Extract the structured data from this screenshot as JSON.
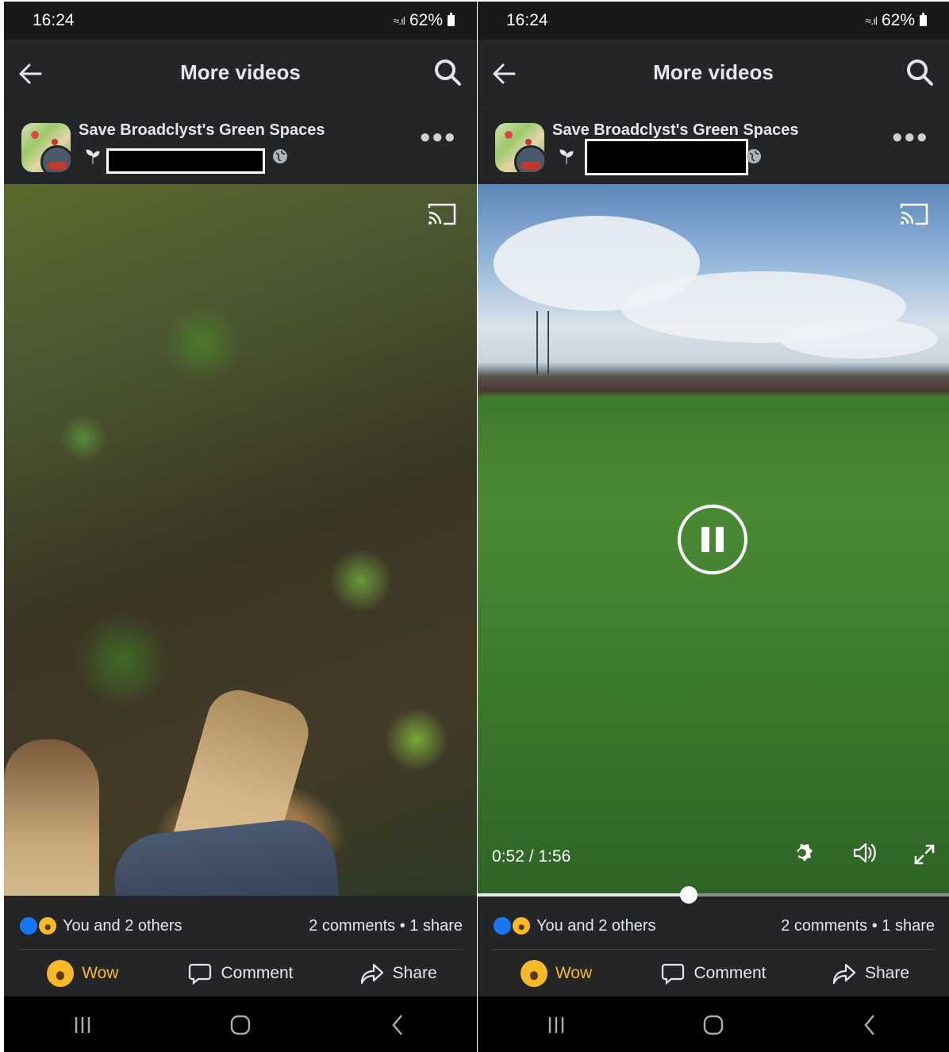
{
  "phones": [
    {
      "status": {
        "time": "16:24",
        "battery": "62%"
      },
      "topbar": {
        "title": "More videos"
      },
      "post": {
        "page_name": "Save Broadclyst's Green Spaces"
      },
      "video": {
        "state": "thumbnail"
      },
      "reactions": {
        "summary": "You and 2 others",
        "stats": "2 comments • 1 share"
      },
      "actions": {
        "wow": "Wow",
        "comment": "Comment",
        "share": "Share"
      }
    },
    {
      "status": {
        "time": "16:24",
        "battery": "62%"
      },
      "topbar": {
        "title": "More videos"
      },
      "post": {
        "page_name": "Save Broadclyst's Green Spaces"
      },
      "video": {
        "state": "playing",
        "timecode": "0:52 / 1:56",
        "progress": 0.448
      },
      "reactions": {
        "summary": "You and 2 others",
        "stats": "2 comments • 1 share"
      },
      "actions": {
        "wow": "Wow",
        "comment": "Comment",
        "share": "Share"
      }
    }
  ],
  "icons": {
    "back": "arrow-left-icon",
    "search": "search-icon",
    "more": "more-icon",
    "cast": "cast-icon",
    "pause": "pause-icon",
    "settings": "gear-icon",
    "volume": "volume-icon",
    "fullscreen": "fullscreen-icon",
    "like": "like-icon",
    "wow": "wow-icon",
    "comment": "comment-icon",
    "share": "share-icon",
    "recents": "recents-icon",
    "home": "home-icon",
    "nav-back": "nav-back-icon"
  },
  "colors": {
    "background": "#242526",
    "accent_blue": "#1877f2",
    "wow_yellow": "#f7b928",
    "text": "#e4e6eb"
  }
}
